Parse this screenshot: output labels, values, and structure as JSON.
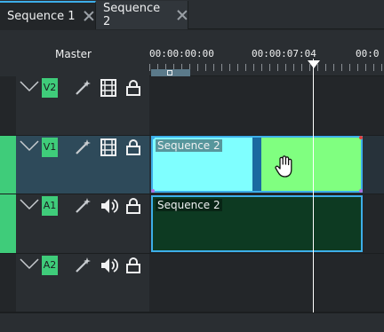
{
  "tabs": [
    {
      "label": "Sequence 1",
      "active": true
    },
    {
      "label": "Sequence 2",
      "active": false
    }
  ],
  "header": {
    "master_label": "Master"
  },
  "ruler": {
    "timecodes": [
      "00:00:00:00",
      "00:00:07:04",
      "00:0"
    ]
  },
  "tracks": [
    {
      "id": "V2",
      "kind": "video",
      "selected": false
    },
    {
      "id": "V1",
      "kind": "video",
      "selected": true
    },
    {
      "id": "A1",
      "kind": "audio",
      "selected": false
    },
    {
      "id": "A2",
      "kind": "audio",
      "selected": false
    }
  ],
  "clips": {
    "video": {
      "title": "Sequence 2"
    },
    "audio": {
      "title": "Sequence 2"
    }
  },
  "colors": {
    "accent": "#3daee9",
    "track_tag": "#3fcc7a",
    "clip_cyan": "#7fffff",
    "clip_green": "#80ff80",
    "audio_clip": "#0d3a22"
  },
  "icons": [
    "chevron-down-icon",
    "magic-wand-icon",
    "film-icon",
    "speaker-icon",
    "lock-icon",
    "close-icon",
    "hand-cursor-icon"
  ]
}
